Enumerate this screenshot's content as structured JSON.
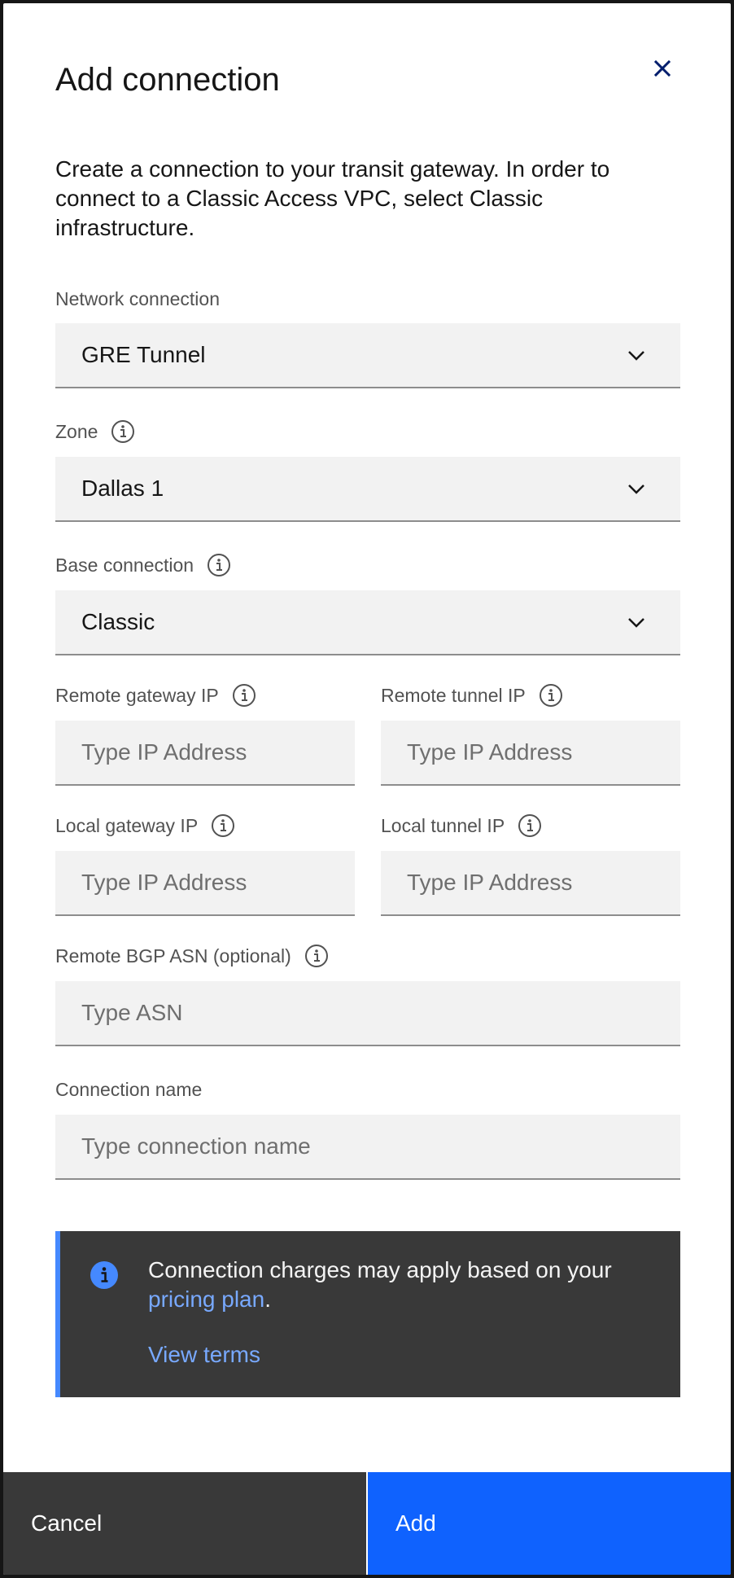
{
  "modal": {
    "title": "Add connection",
    "description": "Create a connection to your transit gateway. In order to connect to a Classic Access VPC, select Classic infrastructure."
  },
  "fields": {
    "network_connection": {
      "label": "Network connection",
      "value": "GRE Tunnel"
    },
    "zone": {
      "label": "Zone",
      "value": "Dallas 1"
    },
    "base_connection": {
      "label": "Base connection",
      "value": "Classic"
    },
    "remote_gateway_ip": {
      "label": "Remote gateway IP",
      "placeholder": "Type IP Address"
    },
    "remote_tunnel_ip": {
      "label": "Remote tunnel IP",
      "placeholder": "Type IP Address"
    },
    "local_gateway_ip": {
      "label": "Local gateway IP",
      "placeholder": "Type IP Address"
    },
    "local_tunnel_ip": {
      "label": "Local tunnel IP",
      "placeholder": "Type IP Address"
    },
    "remote_bgp_asn": {
      "label": "Remote BGP ASN (optional)",
      "placeholder": "Type ASN"
    },
    "connection_name": {
      "label": "Connection name",
      "placeholder": "Type connection name"
    }
  },
  "notification": {
    "text_before": "Connection charges may apply based on your ",
    "link": "pricing plan",
    "text_after": ".",
    "view_terms": "View terms"
  },
  "footer": {
    "cancel_label": "Cancel",
    "add_label": "Add"
  },
  "colors": {
    "primary": "#0f62fe",
    "info": "#4589ff",
    "link": "#78a9ff",
    "dark_surface": "#393939",
    "field_bg": "#f2f2f2"
  },
  "icons": [
    "close-icon",
    "info-icon",
    "chevron-down-icon",
    "info-filled-icon"
  ]
}
